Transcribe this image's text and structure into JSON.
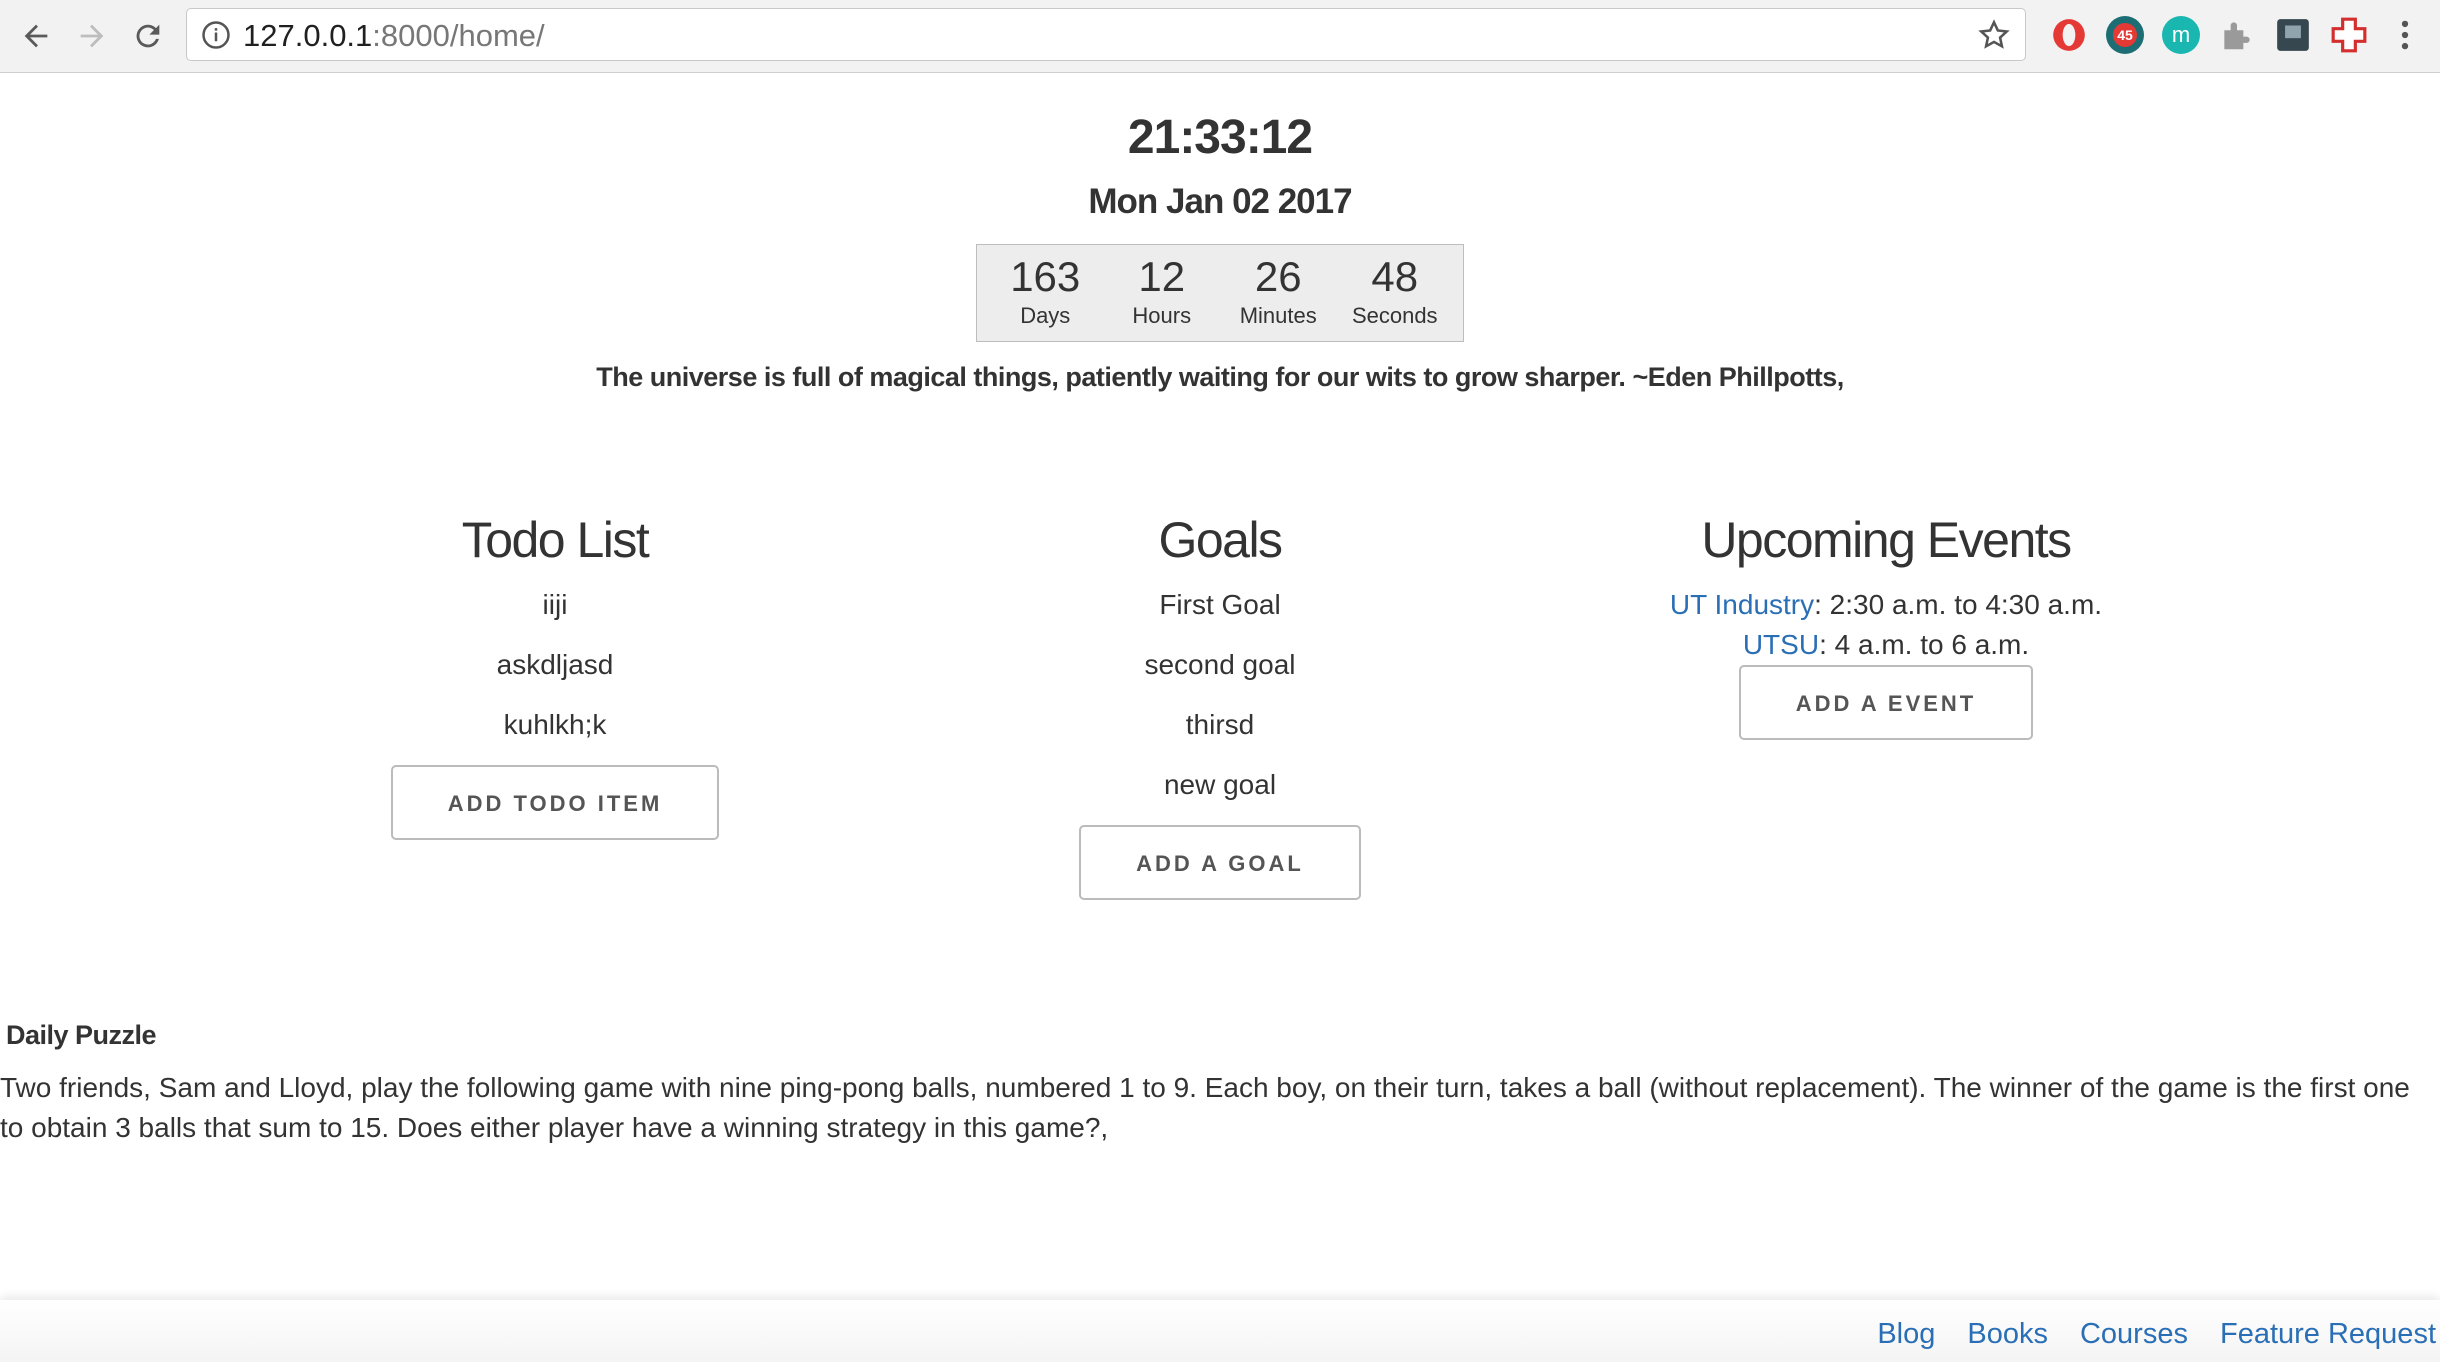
{
  "browser": {
    "url_host": "127.0.0.1",
    "url_rest": ":8000/home/",
    "extension_badge": "45",
    "extension_m": "m"
  },
  "clock": {
    "time": "21:33:12",
    "date": "Mon Jan 02 2017"
  },
  "countdown": [
    {
      "value": "163",
      "label": "Days"
    },
    {
      "value": "12",
      "label": "Hours"
    },
    {
      "value": "26",
      "label": "Minutes"
    },
    {
      "value": "48",
      "label": "Seconds"
    }
  ],
  "quote": "The universe is full of magical things, patiently waiting for our wits to grow sharper. ~Eden Phillpotts,",
  "todo": {
    "title": "Todo List",
    "items": [
      "iiji",
      "askdljasd",
      "kuhlkh;k"
    ],
    "button": "ADD TODO ITEM"
  },
  "goals": {
    "title": "Goals",
    "items": [
      "First Goal",
      "second goal",
      "thirsd",
      "new goal"
    ],
    "button": "ADD A GOAL"
  },
  "events": {
    "title": "Upcoming Events",
    "items": [
      {
        "name": "UT Industry",
        "time": ": 2:30 a.m. to 4:30 a.m."
      },
      {
        "name": "UTSU",
        "time": ": 4 a.m. to 6 a.m."
      }
    ],
    "button": "ADD A EVENT"
  },
  "puzzle": {
    "title": "Daily Puzzle",
    "text": "Two friends, Sam and Lloyd, play the following game with nine ping-pong balls, numbered 1 to 9. Each boy, on their turn, takes a ball (without replacement). The winner of the game is the first one to obtain 3 balls that sum to 15. Does either player have a winning strategy in this game?,"
  },
  "footer": {
    "links": [
      "Blog",
      "Books",
      "Courses",
      "Feature Request"
    ]
  },
  "colors": {
    "link": "#2a6fb5",
    "text": "#333333",
    "countdown_bg": "#ededed"
  }
}
